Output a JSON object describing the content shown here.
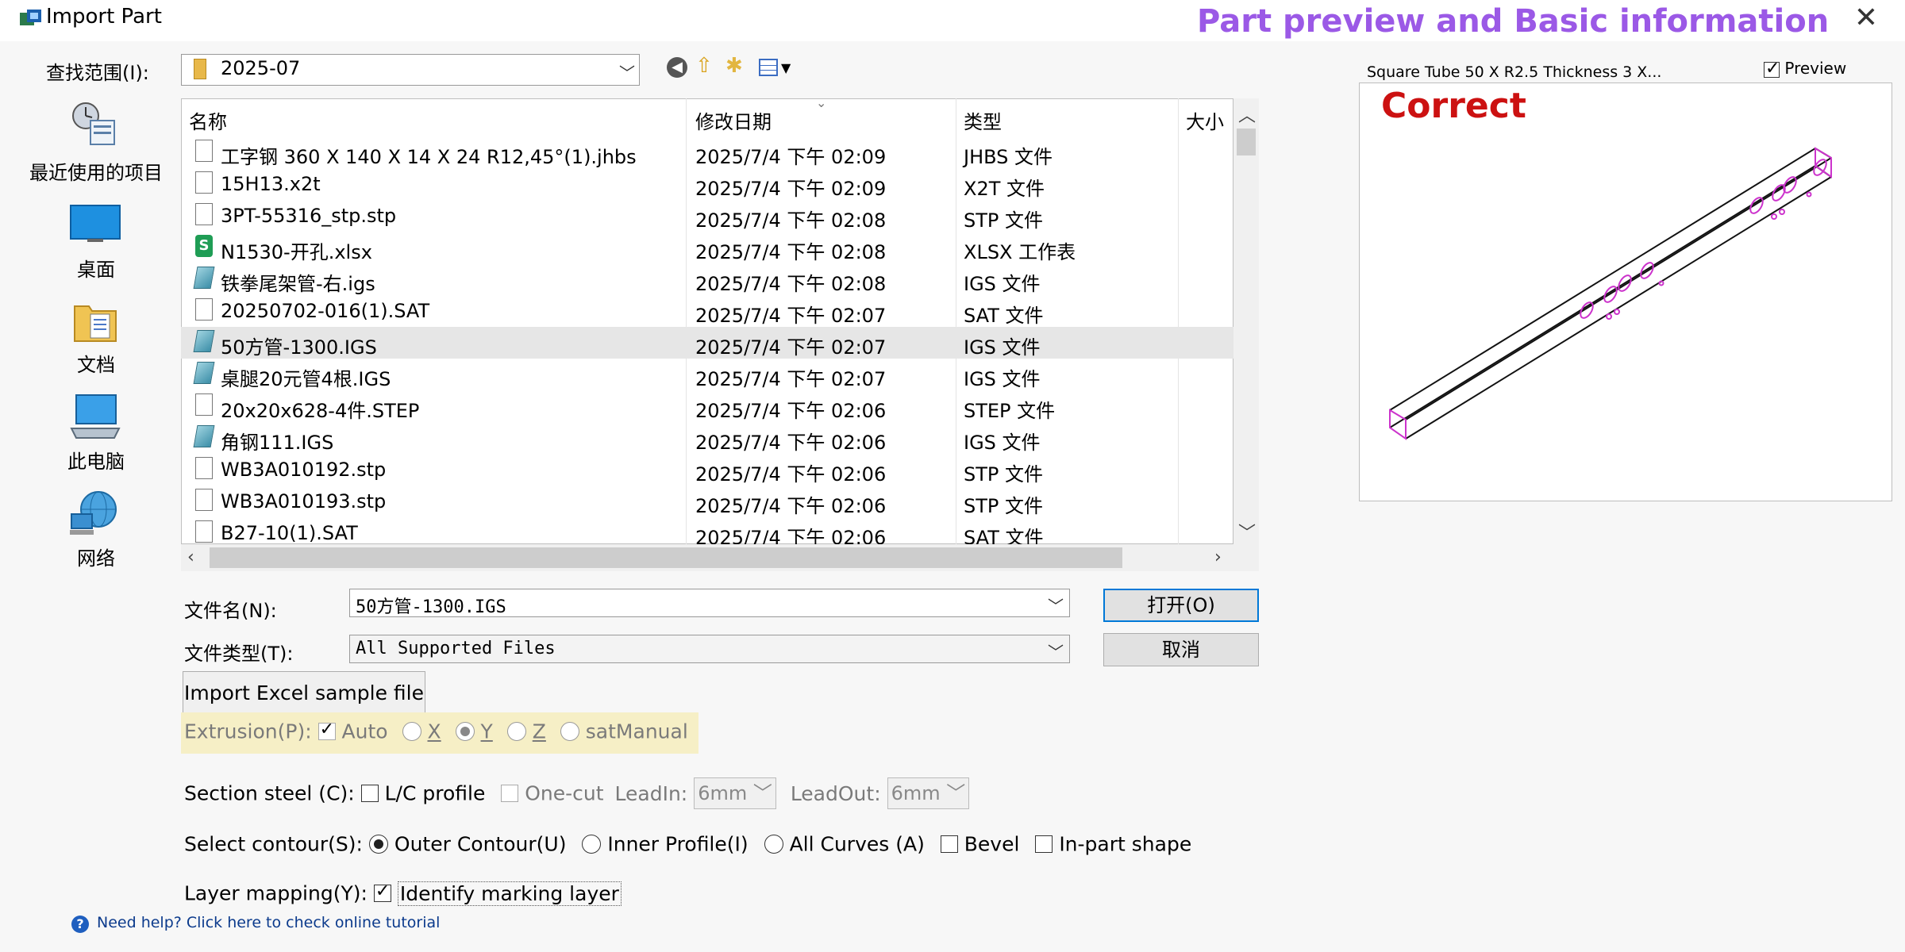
{
  "window": {
    "title": "Import Part",
    "close_glyph": "✕"
  },
  "annotations": {
    "heading": "Part  preview and Basic information",
    "verdict": "Correct"
  },
  "lookin": {
    "label": "查找范围(I):",
    "value": "2025-07"
  },
  "places": [
    {
      "label": "最近使用的项目",
      "icon": "recent-items-icon"
    },
    {
      "label": "桌面",
      "icon": "desktop-icon"
    },
    {
      "label": "文档",
      "icon": "documents-icon"
    },
    {
      "label": "此电脑",
      "icon": "this-pc-icon"
    },
    {
      "label": "网络",
      "icon": "network-icon"
    }
  ],
  "columns": {
    "name": "名称",
    "modified": "修改日期",
    "type": "类型",
    "size": "大小"
  },
  "files": [
    {
      "name": "工字钢 360 X 140 X 14 X 24  R12,45°(1).jhbs",
      "date": "2025/7/4 下午 02:09",
      "type": "JHBS 文件",
      "icon": "doc"
    },
    {
      "name": "15H13.x2t",
      "date": "2025/7/4 下午 02:09",
      "type": "X2T 文件",
      "icon": "doc"
    },
    {
      "name": "3PT-55316_stp.stp",
      "date": "2025/7/4 下午 02:08",
      "type": "STP 文件",
      "icon": "doc"
    },
    {
      "name": "N1530-开孔.xlsx",
      "date": "2025/7/4 下午 02:08",
      "type": "XLSX 工作表",
      "icon": "xls"
    },
    {
      "name": "铁拳尾架管-右.igs",
      "date": "2025/7/4 下午 02:08",
      "type": "IGS 文件",
      "icon": "igs"
    },
    {
      "name": "20250702-016(1).SAT",
      "date": "2025/7/4 下午 02:07",
      "type": "SAT 文件",
      "icon": "doc"
    },
    {
      "name": "50方管-1300.IGS",
      "date": "2025/7/4 下午 02:07",
      "type": "IGS 文件",
      "icon": "igs",
      "selected": true
    },
    {
      "name": "桌腿20元管4根.IGS",
      "date": "2025/7/4 下午 02:07",
      "type": "IGS 文件",
      "icon": "igs"
    },
    {
      "name": "20x20x628-4件.STEP",
      "date": "2025/7/4 下午 02:06",
      "type": "STEP 文件",
      "icon": "doc"
    },
    {
      "name": "角钢111.IGS",
      "date": "2025/7/4 下午 02:06",
      "type": "IGS 文件",
      "icon": "igs"
    },
    {
      "name": "WB3A010192.stp",
      "date": "2025/7/4 下午 02:06",
      "type": "STP 文件",
      "icon": "doc"
    },
    {
      "name": "WB3A010193.stp",
      "date": "2025/7/4 下午 02:06",
      "type": "STP 文件",
      "icon": "doc"
    },
    {
      "name": "B27-10(1).SAT",
      "date": "2025/7/4 下午 02:06",
      "type": "SAT 文件",
      "icon": "doc"
    }
  ],
  "filename": {
    "label": "文件名(N):",
    "value": "50方管-1300.IGS"
  },
  "filetype": {
    "label": "文件类型(T):",
    "value": "All Supported Files"
  },
  "buttons": {
    "open": "打开(O)",
    "cancel": "取消",
    "import_excel": "Import Excel sample file"
  },
  "extrusion": {
    "label": "Extrusion(P):",
    "auto": "Auto",
    "x": "X",
    "y": "Y",
    "z": "Z",
    "sat_manual": "satManual",
    "auto_checked": true,
    "selected": "Y"
  },
  "section_steel": {
    "label": "Section steel (C):",
    "lc_profile": "L/C profile",
    "one_cut": "One-cut",
    "lead_in_label": "LeadIn:",
    "lead_in_value": "6mm",
    "lead_out_label": "LeadOut:",
    "lead_out_value": "6mm"
  },
  "select_contour": {
    "label": "Select contour(S):",
    "outer": "Outer Contour(U)",
    "inner": "Inner Profile(I)",
    "all_curves": "All Curves (A)",
    "bevel": "Bevel",
    "in_part": "In-part shape",
    "selected": "outer"
  },
  "layer_mapping": {
    "label": "Layer mapping(Y):",
    "identify": "Identify marking layer",
    "checked": true
  },
  "preview": {
    "title": "Square Tube 50 X R2.5 Thickness 3 X...",
    "checkbox_label": "Preview",
    "checked": true
  },
  "help": {
    "text": "Need help? Click here to check online tutorial"
  },
  "colors": {
    "accent": "#0078d7",
    "annot_purple": "#9b59e6",
    "annot_red": "#cc1111",
    "model_lines": "#111111",
    "model_holes": "#cc33cc"
  }
}
